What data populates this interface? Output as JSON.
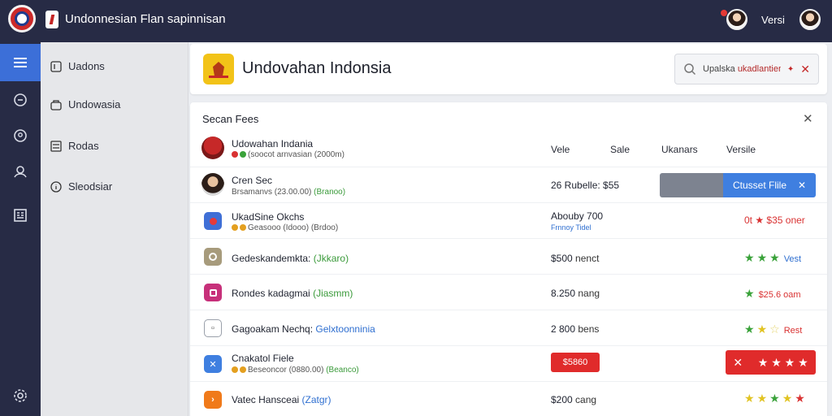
{
  "topbar": {
    "title": "Undonnesian Flan sapinnisan",
    "right_label": "Versi",
    "icons": [
      "app-logo",
      "title-icon",
      "user-avatar",
      "notification-dot",
      "profile-avatar"
    ]
  },
  "rail": {
    "items": [
      {
        "icon": "menu-icon",
        "active": true
      },
      {
        "icon": "chat-icon"
      },
      {
        "icon": "location-icon"
      },
      {
        "icon": "user-icon"
      },
      {
        "icon": "document-icon"
      },
      {
        "icon": "settings-icon"
      }
    ]
  },
  "sidebar": {
    "items": [
      {
        "label": "Uadons",
        "icon": "box-icon"
      },
      {
        "label": "Undowasia",
        "icon": "bag-icon"
      },
      {
        "label": "Rodas",
        "icon": "list-icon"
      },
      {
        "label": "Sleodsiar",
        "icon": "info-icon"
      }
    ]
  },
  "header": {
    "title": "Undovahan Indonsia",
    "search": {
      "prefix": "Upalska",
      "value": "ukadlantien",
      "clear_icon": "close-icon"
    }
  },
  "card": {
    "title": "Secan Fees",
    "columns": [
      "Vele",
      "Sale",
      "Ukanars",
      "Versile"
    ],
    "rows": [
      {
        "name": "Udowahan Indania",
        "sub": "(soocot arnvasian (2000m)",
        "dots": [
          "#d93232",
          "#3aa23a"
        ]
      },
      {
        "name": "Cren Sec",
        "sub_main": "Brsamanvs (23.00.00)",
        "sub_tag": "(Branoo)",
        "value": "26 Rubelle: $55",
        "action": "Ctusset Flile",
        "action_close": "✕"
      },
      {
        "name": "UkadSine Okchs",
        "sub": "Geasooo (Idooo) (Brdoo)",
        "dots": [
          "#e4a020",
          "#e4a020"
        ],
        "value": "Abouby 700",
        "value_sub": "Frnnoy Tidel",
        "rating_text": "0t ★ $35 oner"
      },
      {
        "name": "Gedeskandemkta:",
        "tag": "(Jkkaro)",
        "value": "$500",
        "unit": "nenct",
        "rating_text": "Vest"
      },
      {
        "name": "Rondes kadagmai",
        "tag": "(Jiasmm)",
        "value": "8.250",
        "unit": "nang",
        "rating_text": "$25.6 oam"
      },
      {
        "name": "Gagoakam Nechq:",
        "tag": "Gelxtoonninia",
        "value": "2 800",
        "unit": "bens",
        "rating_text": "Rest"
      },
      {
        "name": "Cnakatol Fiele",
        "sub_main": "Beseoncor (0880.00)",
        "sub_tag": "(Beanco)",
        "dots": [
          "#e4a020",
          "#e4a020"
        ],
        "value": "$5860",
        "rating_text": "★ ★ ★ ★"
      },
      {
        "name": "Vatec Hansceai",
        "tag": "(Zatgr)",
        "value": "$200",
        "unit": "cang"
      }
    ]
  },
  "colors": {
    "topbar_bg": "#272b45",
    "accent_blue": "#3f7fe0",
    "alert_red": "#e02b2b",
    "tag_green": "#3a9a3a",
    "brand_yellow": "#f2c318"
  }
}
